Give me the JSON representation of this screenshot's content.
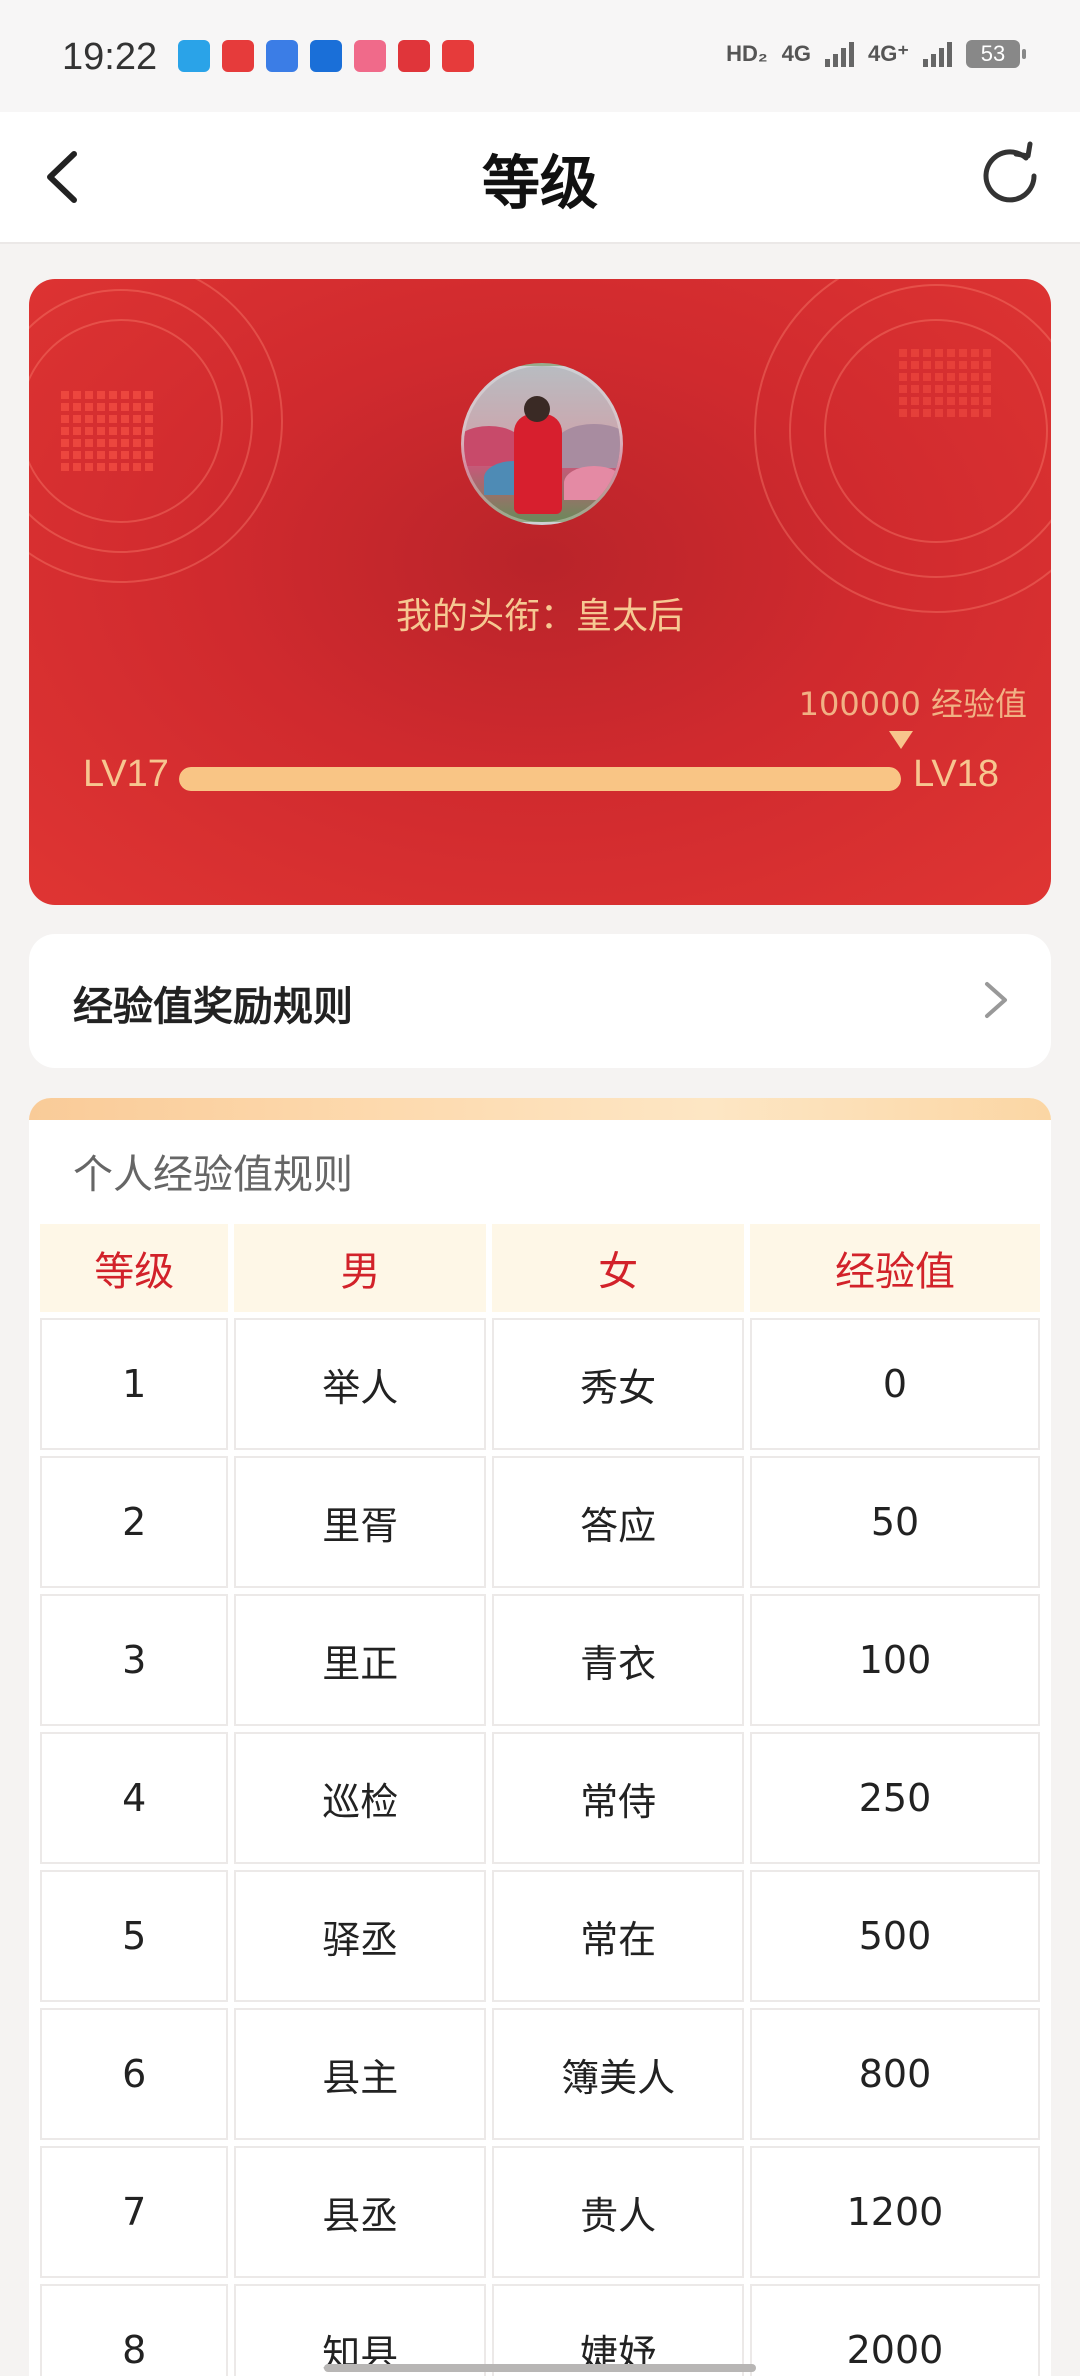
{
  "status_bar": {
    "time": "19:22",
    "hd_label": "HD₂",
    "net1": "4G",
    "net2": "4G⁺",
    "battery": "53"
  },
  "nav": {
    "title": "等级",
    "back_icon": "chevron-left-icon",
    "refresh_icon": "refresh-icon"
  },
  "level_card": {
    "title_text": "我的头衔：皇太后",
    "exp_text": "100000 经验值",
    "current_level": "LV17",
    "next_level": "LV18",
    "progress": 1.0
  },
  "rules_entry": {
    "label": "经验值奖励规则"
  },
  "personal_rules": {
    "title": "个人经验值规则",
    "headers": [
      "等级",
      "男",
      "女",
      "经验值"
    ],
    "rows": [
      [
        "1",
        "举人",
        "秀女",
        "0"
      ],
      [
        "2",
        "里胥",
        "答应",
        "50"
      ],
      [
        "3",
        "里正",
        "青衣",
        "100"
      ],
      [
        "4",
        "巡检",
        "常侍",
        "250"
      ],
      [
        "5",
        "驿丞",
        "常在",
        "500"
      ],
      [
        "6",
        "县主",
        "簿美人",
        "800"
      ],
      [
        "7",
        "县丞",
        "贵人",
        "1200"
      ],
      [
        "8",
        "知县",
        "婕妤",
        "2000"
      ]
    ]
  },
  "colors": {
    "card_red": "#d02a2e",
    "accent_gold": "#f9c585",
    "header_red": "#d2222a"
  }
}
